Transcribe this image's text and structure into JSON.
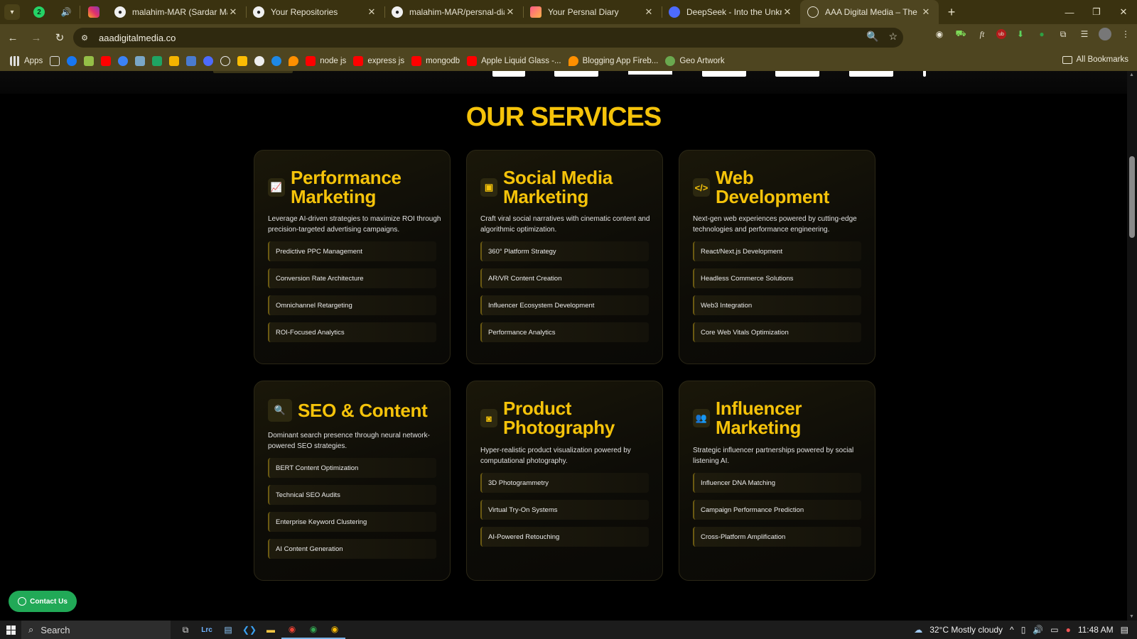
{
  "browser": {
    "tabs": [
      {
        "title": "malahim-MAR (Sardar Malahim",
        "icon": "github-icon",
        "active": false
      },
      {
        "title": "Your Repositories",
        "icon": "github-icon",
        "active": false
      },
      {
        "title": "malahim-MAR/persnal-diary-re",
        "icon": "github-icon",
        "active": false
      },
      {
        "title": "Your Persnal Diary",
        "icon": "diary-icon",
        "active": false
      },
      {
        "title": "DeepSeek - Into the Unknown",
        "icon": "deepseek-icon",
        "active": false
      },
      {
        "title": "AAA Digital Media – The Brand",
        "icon": "globe-icon",
        "active": true
      }
    ],
    "pinned_badge": "2",
    "url": "aaadigitalmedia.co",
    "bookmarks": [
      {
        "label": "Apps",
        "icon": "apps-grid-icon"
      },
      {
        "label": "node js",
        "icon": "youtube-icon"
      },
      {
        "label": "express js",
        "icon": "youtube-icon"
      },
      {
        "label": "mongodb",
        "icon": "youtube-icon"
      },
      {
        "label": "Apple Liquid Glass -...",
        "icon": "youtube-icon"
      },
      {
        "label": "Blogging App Fireb...",
        "icon": "firebase-icon"
      },
      {
        "label": "Geo Artwork",
        "icon": "geo-icon"
      }
    ],
    "all_bookmarks": "All Bookmarks"
  },
  "page": {
    "section_title": "OUR SERVICES",
    "accent_color": "#f5c30a",
    "cards": [
      {
        "title": "Performance Marketing",
        "icon": "chart-line-icon",
        "description": "Leverage AI-driven strategies to maximize ROI through precision-targeted advertising campaigns.",
        "features": [
          "Predictive PPC Management",
          "Conversion Rate Architecture",
          "Omnichannel Retargeting",
          "ROI-Focused Analytics"
        ]
      },
      {
        "title": "Social Media Marketing",
        "icon": "calendar-icon",
        "description": "Craft viral social narratives with cinematic content and algorithmic optimization.",
        "features": [
          "360° Platform Strategy",
          "AR/VR Content Creation",
          "Influencer Ecosystem Development",
          "Performance Analytics"
        ]
      },
      {
        "title": "Web Development",
        "icon": "code-icon",
        "description": "Next-gen web experiences powered by cutting-edge technologies and performance engineering.",
        "features": [
          "React/Next.js Development",
          "Headless Commerce Solutions",
          "Web3 Integration",
          "Core Web Vitals Optimization"
        ]
      },
      {
        "title": "SEO & Content",
        "icon": "search-icon",
        "description": "Dominant search presence through neural network-powered SEO strategies.",
        "features": [
          "BERT Content Optimization",
          "Technical SEO Audits",
          "Enterprise Keyword Clustering",
          "AI Content Generation"
        ]
      },
      {
        "title": "Product Photography",
        "icon": "camera-icon",
        "description": "Hyper-realistic product visualization powered by computational photography.",
        "features": [
          "3D Photogrammetry",
          "Virtual Try-On Systems",
          "AI-Powered Retouching"
        ]
      },
      {
        "title": "Influencer Marketing",
        "icon": "users-icon",
        "description": "Strategic influencer partnerships powered by social listening AI.",
        "features": [
          "Influencer DNA Matching",
          "Campaign Performance Prediction",
          "Cross-Platform Amplification"
        ]
      }
    ],
    "contact_button": "Contact Us"
  },
  "taskbar": {
    "search_placeholder": "Search",
    "weather": "32°C  Mostly cloudy",
    "time": "11:48 AM"
  }
}
